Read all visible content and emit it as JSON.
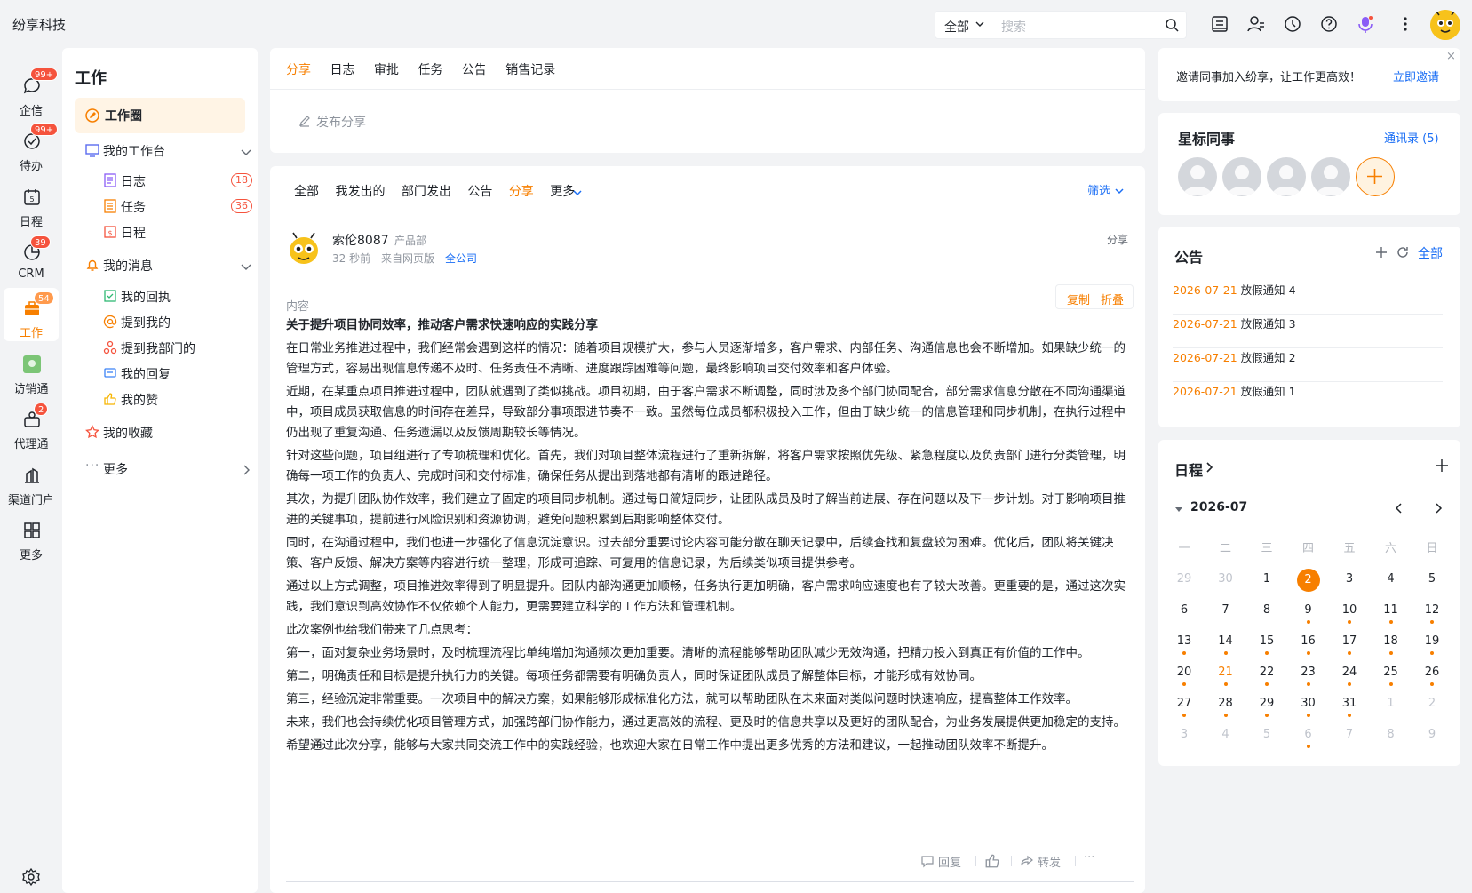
{
  "app": {
    "brand": "纷享科技",
    "avatar_icon": "bee-mascot",
    "accent": "#f77f00",
    "link_color": "#1a6ef5"
  },
  "topbar": {
    "search_scope": "全部",
    "search_placeholder": "搜索",
    "icons": [
      "notebook-icon",
      "contacts-icon",
      "history-icon",
      "help-icon",
      "assistant-icon",
      "more-vertical-icon"
    ]
  },
  "nav": {
    "items": [
      {
        "label": "企信",
        "icon": "chat-icon",
        "badge": "99+"
      },
      {
        "label": "待办",
        "icon": "todo-icon",
        "badge": "99+"
      },
      {
        "label": "日程",
        "icon": "calendar-icon",
        "badge": ""
      },
      {
        "label": "CRM",
        "icon": "crm-icon",
        "badge": "39"
      },
      {
        "label": "工作",
        "icon": "briefcase-icon",
        "badge": "54",
        "active": true
      },
      {
        "label": "访销通",
        "icon": "visit-icon",
        "badge": ""
      },
      {
        "label": "代理通",
        "icon": "agent-icon",
        "badge": "2"
      },
      {
        "label": "渠道门户",
        "icon": "portal-icon",
        "badge": ""
      },
      {
        "label": "更多",
        "icon": "grid-icon",
        "badge": ""
      }
    ],
    "settings_icon": "settings-icon"
  },
  "sidebar": {
    "title": "工作",
    "work_circle": "工作圈",
    "my_workbench": "我的工作台",
    "workbench_items": [
      {
        "label": "日志",
        "count": "18"
      },
      {
        "label": "任务",
        "count": "36"
      },
      {
        "label": "日程",
        "count": ""
      }
    ],
    "my_messages": "我的消息",
    "message_items": [
      {
        "label": "我的回执"
      },
      {
        "label": "提到我的"
      },
      {
        "label": "提到我部门的"
      },
      {
        "label": "我的回复"
      },
      {
        "label": "我的赞"
      }
    ],
    "favorites": "我的收藏",
    "more": "更多"
  },
  "composer": {
    "tabs": [
      "分享",
      "日志",
      "审批",
      "任务",
      "公告",
      "销售记录"
    ],
    "active_tab": "分享",
    "placeholder": "发布分享"
  },
  "feed": {
    "filters": [
      "全部",
      "我发出的",
      "部门发出",
      "公告",
      "分享",
      "更多"
    ],
    "active_filter": "分享",
    "filter_button": "筛选",
    "post": {
      "author": "索伦8087",
      "dept": "产品部",
      "time": "32 秒前 - 来自网页版 - ",
      "scope": "全公司",
      "type": "分享",
      "content_label": "内容",
      "copy": "复制",
      "fold": "折叠",
      "title": "关于提升项目协同效率，推动客户需求快速响应的实践分享",
      "paragraphs": [
        "在日常业务推进过程中，我们经常会遇到这样的情况：随着项目规模扩大，参与人员逐渐增多，客户需求、内部任务、沟通信息也会不断增加。如果缺少统一的管理方式，容易出现信息传递不及时、任务责任不清晰、进度跟踪困难等问题，最终影响项目交付效率和客户体验。",
        "近期，在某重点项目推进过程中，团队就遇到了类似挑战。项目初期，由于客户需求不断调整，同时涉及多个部门协同配合，部分需求信息分散在不同沟通渠道中，项目成员获取信息的时间存在差异，导致部分事项跟进节奏不一致。虽然每位成员都积极投入工作，但由于缺少统一的信息管理和同步机制，在执行过程中仍出现了重复沟通、任务遗漏以及反馈周期较长等情况。",
        "针对这些问题，项目组进行了专项梳理和优化。首先，我们对项目整体流程进行了重新拆解，将客户需求按照优先级、紧急程度以及负责部门进行分类管理，明确每一项工作的负责人、完成时间和交付标准，确保任务从提出到落地都有清晰的跟进路径。",
        "其次，为提升团队协作效率，我们建立了固定的项目同步机制。通过每日简短同步，让团队成员及时了解当前进展、存在问题以及下一步计划。对于影响项目推进的关键事项，提前进行风险识别和资源协调，避免问题积累到后期影响整体交付。",
        "同时，在沟通过程中，我们也进一步强化了信息沉淀意识。过去部分重要讨论内容可能分散在聊天记录中，后续查找和复盘较为困难。优化后，团队将关键决策、客户反馈、解决方案等内容进行统一整理，形成可追踪、可复用的信息记录，为后续类似项目提供参考。",
        "通过以上方式调整，项目推进效率得到了明显提升。团队内部沟通更加顺畅，任务执行更加明确，客户需求响应速度也有了较大改善。更重要的是，通过这次实践，我们意识到高效协作不仅依赖个人能力，更需要建立科学的工作方法和管理机制。",
        "此次案例也给我们带来了几点思考：",
        "第一，面对复杂业务场景时，及时梳理流程比单纯增加沟通频次更加重要。清晰的流程能够帮助团队减少无效沟通，把精力投入到真正有价值的工作中。",
        "第二，明确责任和目标是提升执行力的关键。每项任务都需要有明确负责人，同时保证团队成员了解整体目标，才能形成有效协同。",
        "第三，经验沉淀非常重要。一次项目中的解决方案，如果能够形成标准化方法，就可以帮助团队在未来面对类似问题时快速响应，提高整体工作效率。",
        "未来，我们也会持续优化项目管理方式，加强跨部门协作能力，通过更高效的流程、更及时的信息共享以及更好的团队配合，为业务发展提供更加稳定的支持。",
        "希望通过此次分享，能够与大家共同交流工作中的实践经验，也欢迎大家在日常工作中提出更多优秀的方法和建议，一起推动团队效率不断提升。"
      ],
      "actions": {
        "reply": "回复",
        "forward": "转发",
        "more": "···"
      }
    }
  },
  "invite": {
    "text": "邀请同事加入纷享，让工作更高效！",
    "link": "立即邀请"
  },
  "starred": {
    "title": "星标同事",
    "contacts_link": "通讯录 (5)"
  },
  "notices": {
    "title": "公告",
    "all": "全部",
    "items": [
      {
        "date": "2026-07-21",
        "title": "放假通知 4"
      },
      {
        "date": "2026-07-21",
        "title": "放假通知 3"
      },
      {
        "date": "2026-07-21",
        "title": "放假通知 2"
      },
      {
        "date": "2026-07-21",
        "title": "放假通知 1"
      }
    ]
  },
  "schedule": {
    "title": "日程",
    "month": "2026-07",
    "weekdays": [
      "一",
      "二",
      "三",
      "四",
      "五",
      "六",
      "日"
    ],
    "weeks": [
      [
        {
          "d": "29",
          "dim": true
        },
        {
          "d": "30",
          "dim": true
        },
        {
          "d": "1"
        },
        {
          "d": "2",
          "today": true
        },
        {
          "d": "3"
        },
        {
          "d": "4"
        },
        {
          "d": "5"
        }
      ],
      [
        {
          "d": "6"
        },
        {
          "d": "7"
        },
        {
          "d": "8"
        },
        {
          "d": "9",
          "dot": true
        },
        {
          "d": "10",
          "dot": true
        },
        {
          "d": "11",
          "dot": true
        },
        {
          "d": "12",
          "dot": true
        }
      ],
      [
        {
          "d": "13",
          "dot": true
        },
        {
          "d": "14",
          "dot": true
        },
        {
          "d": "15",
          "dot": true
        },
        {
          "d": "16",
          "dot": true
        },
        {
          "d": "17",
          "dot": true
        },
        {
          "d": "18",
          "dot": true
        },
        {
          "d": "19",
          "dot": true
        }
      ],
      [
        {
          "d": "20",
          "dot": true
        },
        {
          "d": "21",
          "dot": true,
          "wk": true
        },
        {
          "d": "22",
          "dot": true
        },
        {
          "d": "23",
          "dot": true
        },
        {
          "d": "24",
          "dot": true
        },
        {
          "d": "25",
          "dot": true
        },
        {
          "d": "26",
          "dot": true
        }
      ],
      [
        {
          "d": "27",
          "dot": true
        },
        {
          "d": "28",
          "dot": true
        },
        {
          "d": "29",
          "dot": true
        },
        {
          "d": "30",
          "dot": true
        },
        {
          "d": "31",
          "dot": true
        },
        {
          "d": "1",
          "dim": true
        },
        {
          "d": "2",
          "dim": true
        }
      ],
      [
        {
          "d": "3",
          "dim": true
        },
        {
          "d": "4",
          "dim": true
        },
        {
          "d": "5",
          "dim": true
        },
        {
          "d": "6",
          "dim": true,
          "dot": true
        },
        {
          "d": "7",
          "dim": true
        },
        {
          "d": "8",
          "dim": true
        },
        {
          "d": "9",
          "dim": true
        }
      ]
    ]
  }
}
